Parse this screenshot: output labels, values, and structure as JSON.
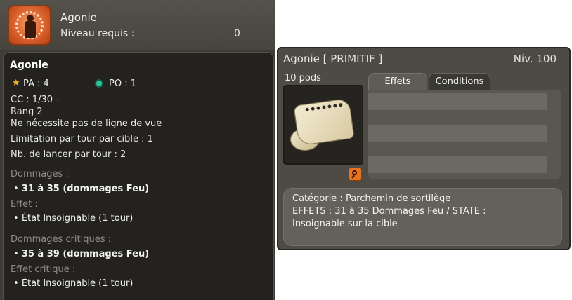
{
  "spell": {
    "name": "Agonie",
    "level_label": "Niveau requis :",
    "level_value": "0",
    "title": "Agonie",
    "pa": "PA : 4",
    "po": "PO : 1",
    "cc": "CC : 1/30 -",
    "rank": "Rang 2",
    "line_of_sight": "Ne nécessite pas de ligne de vue",
    "limit_per_target": "Limitation par tour par cible : 1",
    "casts_per_turn": "Nb. de lancer par tour : 2",
    "damage_label": "Dommages :",
    "damage_value": "31 à 35 (dommages Feu)",
    "effect_label": "Effet :",
    "effect_value": "État Insoignable (1 tour)",
    "crit_damage_label": "Dommages critiques :",
    "crit_damage_value": "35 à 39 (dommages Feu)",
    "crit_effect_label": "Effet critique :",
    "crit_effect_value": "État Insoignable (1 tour)"
  },
  "item": {
    "title": "Agonie [ PRIMITIF ]",
    "level": "Niv. 100",
    "pods": "10 pods",
    "tabs": [
      {
        "label": "Effets",
        "active": true
      },
      {
        "label": "Conditions",
        "active": false
      }
    ],
    "description": [
      "Catégorie : Parchemin de sortilège",
      "EFFETS : 31 à 35 Dommages Feu  / STATE :",
      "Insoignable sur la cible"
    ]
  },
  "icons": {
    "spell": "agonie-spell-icon",
    "pa": "star-icon",
    "po": "eye-icon",
    "item": "scroll-icon",
    "zoom": "magnifier-icon"
  },
  "colors": {
    "panel_bg": "#3f3c37",
    "body_bg": "#24221f",
    "star": "#f1b321",
    "po_eye": "#2ec49a",
    "zoom_button": "#e8731f"
  }
}
